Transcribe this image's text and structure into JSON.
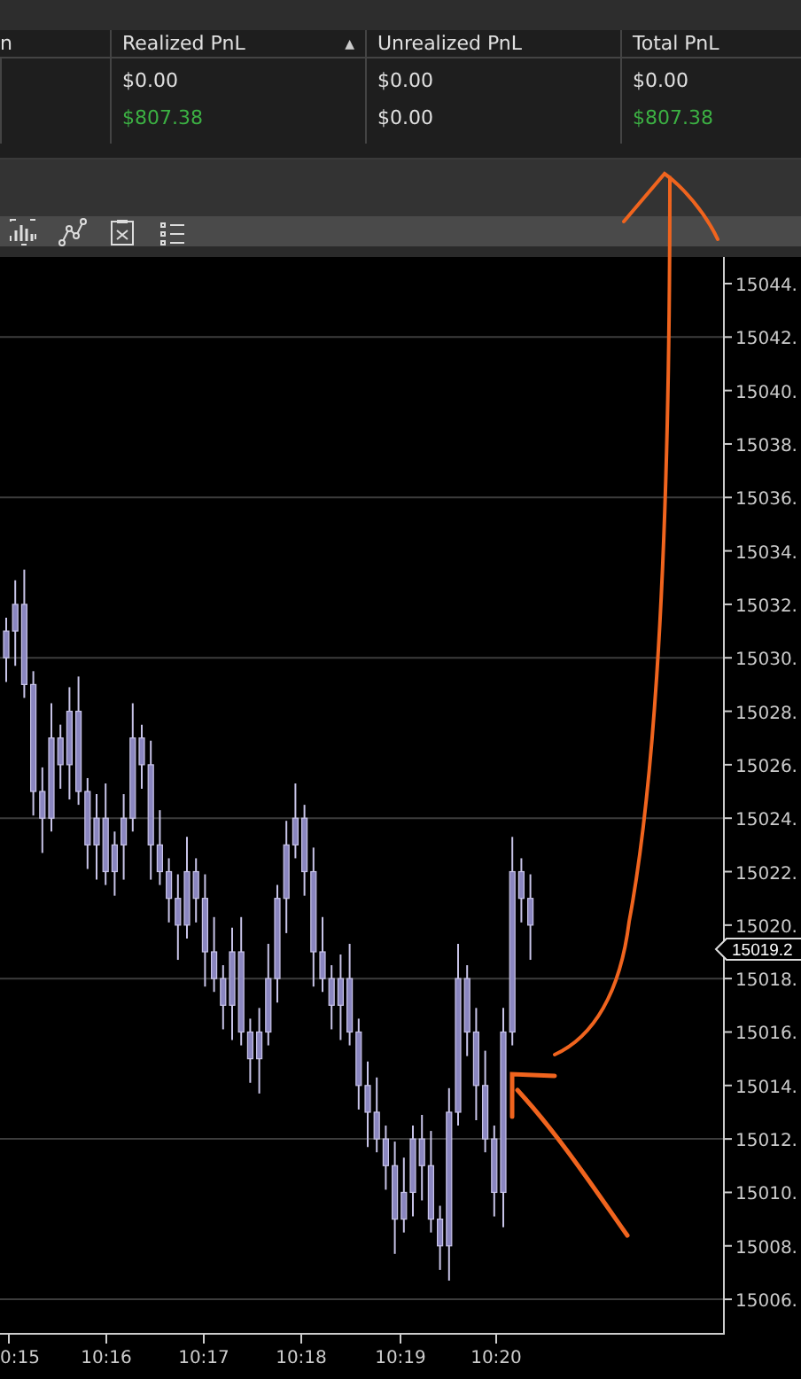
{
  "positions_table": {
    "columns": [
      {
        "label": "n"
      },
      {
        "label": "Realized PnL",
        "sort_indicator": "▲"
      },
      {
        "label": "Unrealized PnL"
      },
      {
        "label": "Total PnL"
      }
    ],
    "rows": [
      {
        "cells": [
          {
            "text": ""
          },
          {
            "text": "$0.00",
            "color": "#e0e0e0"
          },
          {
            "text": "$0.00",
            "color": "#e0e0e0"
          },
          {
            "text": "$0.00",
            "color": "#e0e0e0"
          }
        ]
      },
      {
        "cells": [
          {
            "text": ""
          },
          {
            "text": "$807.38",
            "color": "#3cb043"
          },
          {
            "text": "$0.00",
            "color": "#e0e0e0"
          },
          {
            "text": "$807.38",
            "color": "#3cb043"
          }
        ]
      }
    ]
  },
  "chart": {
    "price_axis": [
      "15044.",
      "15042.",
      "15040.",
      "15038.",
      "15036.",
      "15034.",
      "15032.",
      "15030.",
      "15028.",
      "15026.",
      "15024.",
      "15022.",
      "15020.",
      "15018.",
      "15016.",
      "15014.",
      "15012.",
      "15010.",
      "15008.",
      "15006."
    ],
    "current_price": "15019.2",
    "time_axis": [
      "0:15",
      "10:16",
      "10:17",
      "10:18",
      "10:19",
      "10:20"
    ]
  }
}
